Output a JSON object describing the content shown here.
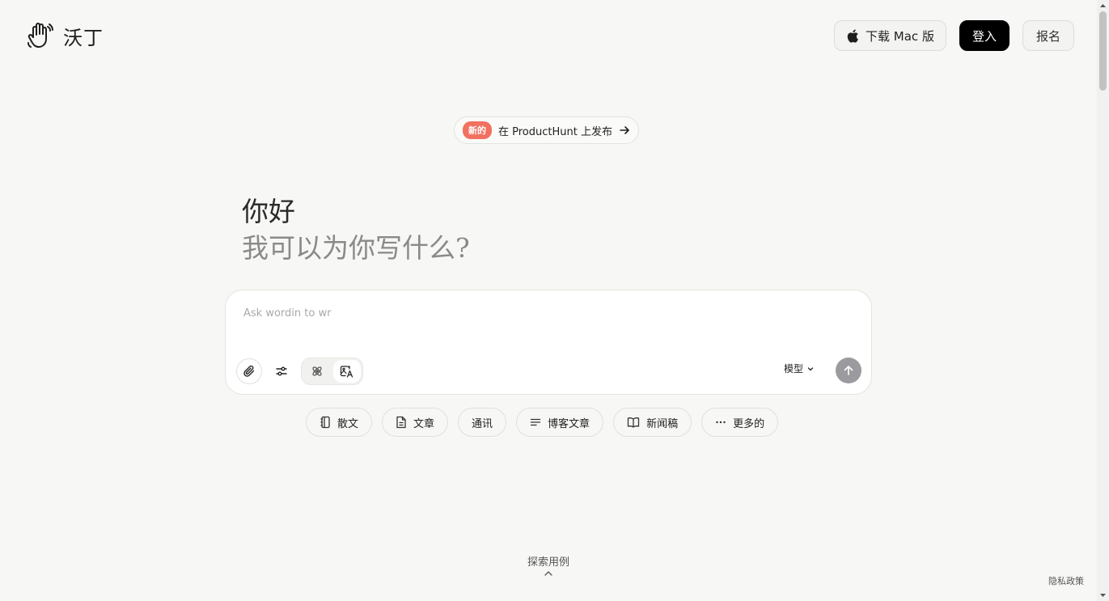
{
  "header": {
    "brand": "沃丁",
    "download_label": "下载 Mac 版",
    "login_label": "登入",
    "signup_label": "报名"
  },
  "announcement": {
    "badge": "新的",
    "text": "在 ProductHunt 上发布"
  },
  "greeting": {
    "line1": "你好",
    "line2": "我可以为你写什么?"
  },
  "composer": {
    "value": "",
    "placeholder": "Ask wordin to wr",
    "model_label": "模型"
  },
  "chips": [
    {
      "label": "散文"
    },
    {
      "label": "文章"
    },
    {
      "label": "通讯"
    },
    {
      "label": "博客文章"
    },
    {
      "label": "新闻稿"
    },
    {
      "label": "更多的"
    }
  ],
  "footer": {
    "explore_label": "探索用例",
    "privacy_label": "隐私政策"
  },
  "colors": {
    "background": "#f7f7f5",
    "badge": "#f2705f",
    "send_button": "#9b9b9f",
    "primary_button": "#000000"
  },
  "icons": [
    "waving-hand-icon",
    "apple-icon",
    "arrow-right-icon",
    "paperclip-icon",
    "sliders-icon",
    "atom-icon",
    "image-translate-icon",
    "chevron-down-icon",
    "arrow-up-icon",
    "notebook-icon",
    "document-icon",
    "lines-icon",
    "open-book-icon",
    "more-dots-icon",
    "chevron-up-icon"
  ]
}
